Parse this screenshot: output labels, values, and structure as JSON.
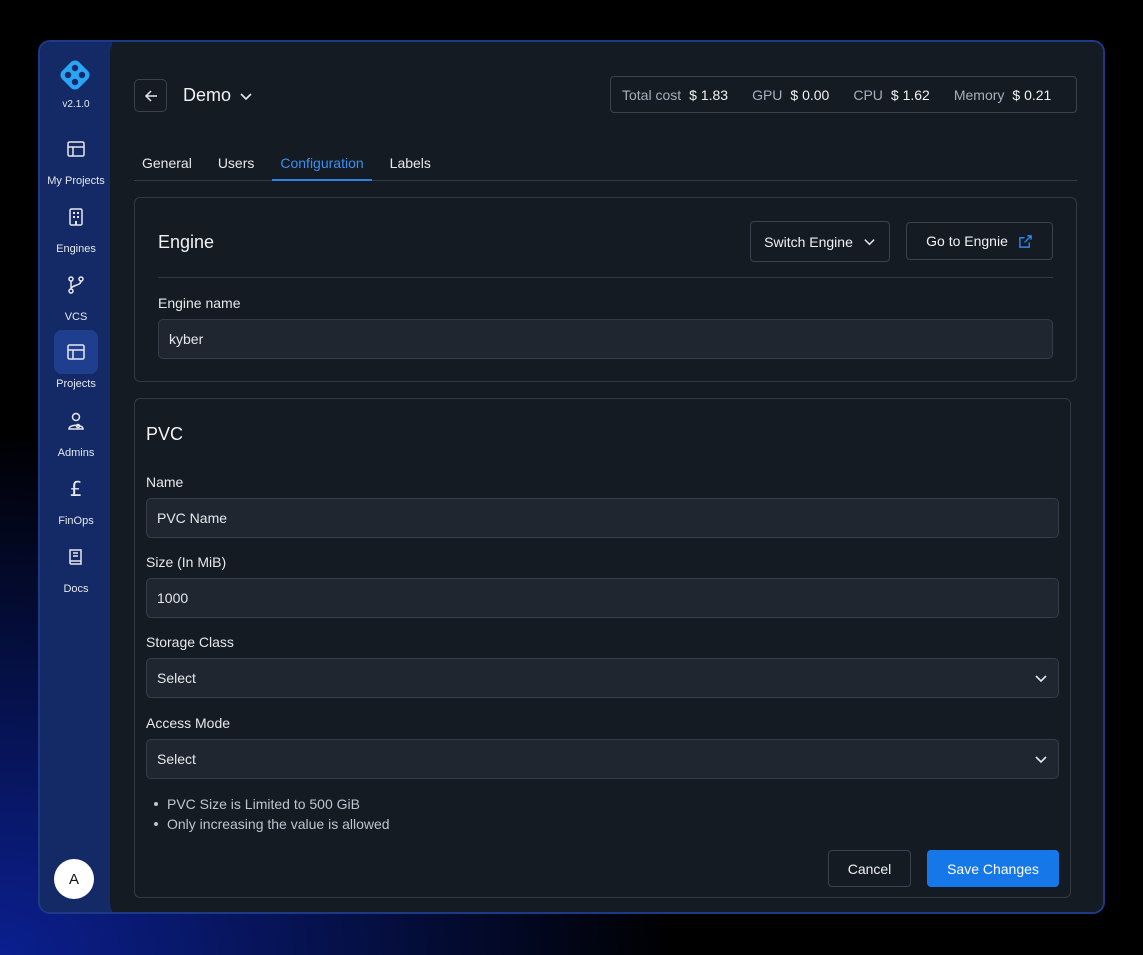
{
  "app": {
    "version": "v2.1.0",
    "brand_color": "#1677e8"
  },
  "sidebar": {
    "items": [
      {
        "label": "My Projects",
        "icon": "layout-icon"
      },
      {
        "label": "Engines",
        "icon": "building-icon"
      },
      {
        "label": "VCS",
        "icon": "git-branch-icon"
      },
      {
        "label": "Projects",
        "icon": "layout-icon",
        "active": true
      },
      {
        "label": "Admins",
        "icon": "admin-user-icon"
      },
      {
        "label": "FinOps",
        "icon": "pound-icon"
      },
      {
        "label": "Docs",
        "icon": "book-icon"
      }
    ],
    "avatar_initial": "A"
  },
  "header": {
    "project_name": "Demo",
    "costs": [
      {
        "label": "Total cost",
        "value": "$ 1.83"
      },
      {
        "label": "GPU",
        "value": "$ 0.00"
      },
      {
        "label": "CPU",
        "value": "$ 1.62"
      },
      {
        "label": "Memory",
        "value": "$ 0.21"
      }
    ]
  },
  "tabs": [
    {
      "label": "General"
    },
    {
      "label": "Users"
    },
    {
      "label": "Configuration",
      "active": true
    },
    {
      "label": "Labels"
    }
  ],
  "engine": {
    "title": "Engine",
    "switch_label": "Switch Engine",
    "goto_label": "Go to Engnie",
    "name_label": "Engine name",
    "name_value": "kyber"
  },
  "pvc": {
    "title": "PVC",
    "name_label": "Name",
    "name_placeholder": "PVC Name",
    "size_label": "Size (In MiB)",
    "size_value": "1000",
    "storage_label": "Storage Class",
    "storage_value": "Select",
    "access_label": "Access Mode",
    "access_value": "Select",
    "notes": [
      "PVC Size is Limited to 500 GiB",
      "Only increasing the value is allowed"
    ],
    "cancel_label": "Cancel",
    "save_label": "Save Changes"
  }
}
